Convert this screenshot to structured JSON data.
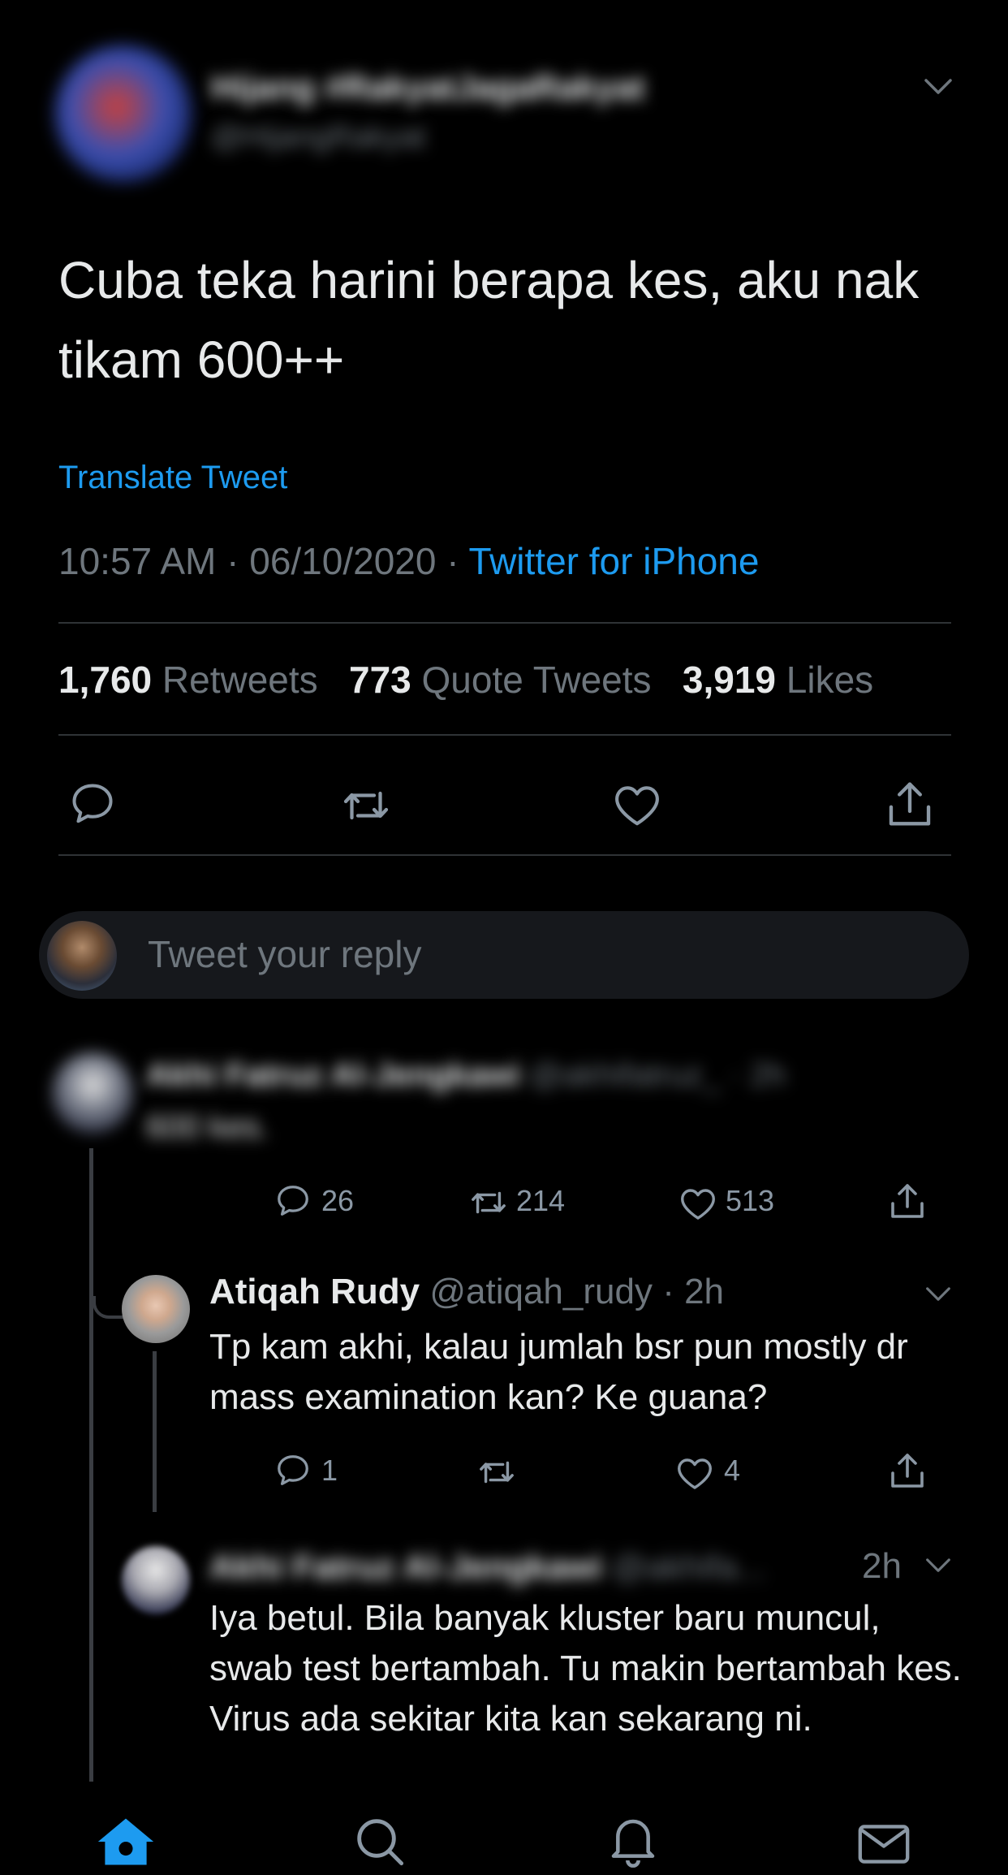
{
  "main_tweet": {
    "author_name": "Hijang #RakyatJagaRakyat",
    "author_handle": "@HijangRakyat",
    "text": "Cuba teka harini berapa kes, aku nak tikam 600++",
    "translate": "Translate Tweet",
    "timestamp": "10:57 AM · 06/10/2020 · ",
    "source": "Twitter for iPhone",
    "stats": {
      "retweets_count": "1,760",
      "retweets_label": "Retweets",
      "quotes_count": "773",
      "quotes_label": "Quote Tweets",
      "likes_count": "3,919",
      "likes_label": "Likes"
    }
  },
  "reply_box": {
    "placeholder": "Tweet your reply"
  },
  "replies": [
    {
      "author_name": "Akhi Fatruz Al-Jengkawi",
      "author_handle": "@akhifatruz_ · 2h",
      "text": "600 kes.",
      "reply_count": "26",
      "retweet_count": "214",
      "like_count": "513"
    },
    {
      "author_name": "Atiqah Rudy",
      "author_handle": "@atiqah_rudy",
      "time": " · 2h",
      "text": "Tp kam akhi, kalau jumlah bsr pun mostly dr mass examination kan? Ke guana?",
      "reply_count": "1",
      "retweet_count": "",
      "like_count": "4"
    },
    {
      "author_name": "Akhi Fatruz Al-Jengkawi",
      "author_handle": "@akhifa...",
      "time": "2h",
      "text": "Iya betul. Bila banyak kluster baru muncul, swab test bertambah. Tu makin bertambah kes. Virus ada sekitar kita kan sekarang ni."
    }
  ],
  "colors": {
    "accent": "#1d9bf0",
    "background": "#000000",
    "muted": "#6e767d"
  },
  "tab_bar": {
    "items": [
      "home-icon",
      "search-icon",
      "notifications-icon",
      "messages-icon"
    ]
  }
}
